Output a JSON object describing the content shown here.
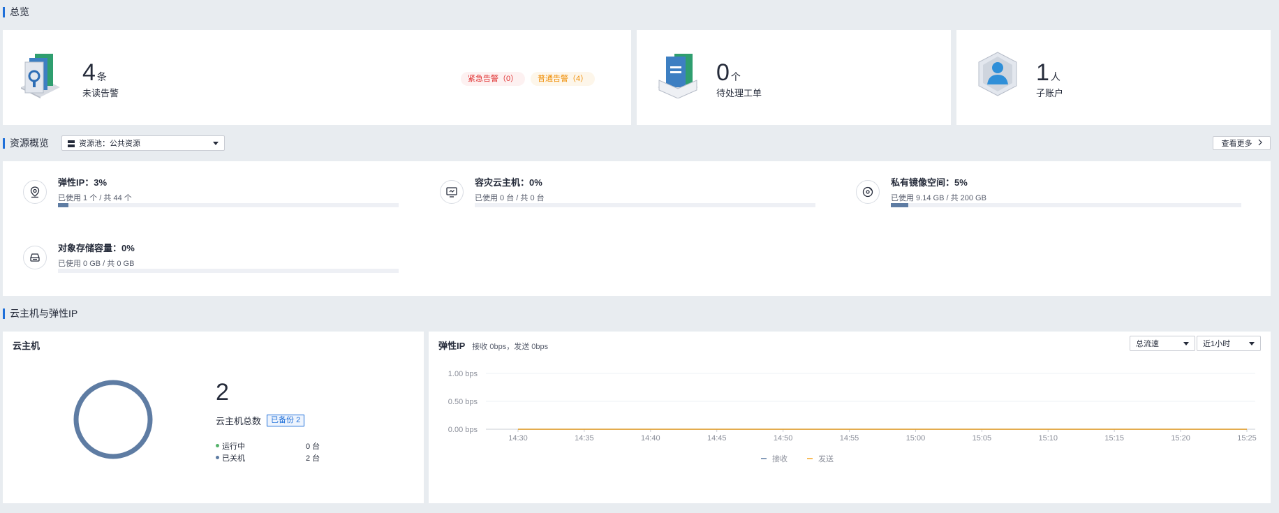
{
  "sections": {
    "overview": "总览",
    "resources": "资源概览",
    "vm_eip": "云主机与弹性IP"
  },
  "alerts": {
    "count": "4",
    "unit": "条",
    "label": "未读告警",
    "urgent": "紧急告警（0）",
    "normal": "普通告警（4）"
  },
  "tickets": {
    "count": "0",
    "unit": "个",
    "label": "待处理工单"
  },
  "subaccounts": {
    "count": "1",
    "unit": "人",
    "label": "子账户"
  },
  "pool": {
    "label": "资源池：公共资源"
  },
  "view_more": "查看更多",
  "resources": [
    {
      "name": "弹性IP：3%",
      "usage": "已使用 1 个 / 共 44 个",
      "percent": 3
    },
    {
      "name": "容灾云主机：0%",
      "usage": "已使用 0 台 / 共 0 台",
      "percent": 0
    },
    {
      "name": "私有镜像空间：5%",
      "usage": "已使用 9.14 GB / 共 200 GB",
      "percent": 5
    },
    {
      "name": "对象存储容量：0%",
      "usage": "已使用 0 GB / 共 0 GB",
      "percent": 0
    }
  ],
  "vm": {
    "title": "云主机",
    "total": "2",
    "total_label": "云主机总数",
    "backup_badge": "已备份 2",
    "status": [
      {
        "label": "运行中",
        "value": "0 台",
        "color": "#55b36b"
      },
      {
        "label": "已关机",
        "value": "2 台",
        "color": "#5e7ca3"
      }
    ],
    "ring_color": "#5e7ca3"
  },
  "eip": {
    "title": "弹性IP",
    "subtitle": "接收 0bps，发送 0bps",
    "select_metric": "总流速",
    "select_range": "近1小时"
  },
  "chart_data": {
    "type": "line",
    "x": [
      "14:30",
      "14:35",
      "14:40",
      "14:45",
      "14:50",
      "14:55",
      "15:00",
      "15:05",
      "15:10",
      "15:15",
      "15:20",
      "15:25"
    ],
    "y_ticks": [
      "1.00 bps",
      "0.50 bps",
      "0.00 bps"
    ],
    "ylim": [
      0,
      1
    ],
    "series": [
      {
        "name": "接收",
        "values": [
          0,
          0,
          0,
          0,
          0,
          0,
          0,
          0,
          0,
          0,
          0,
          0
        ],
        "color": "#5e7ca3"
      },
      {
        "name": "发送",
        "values": [
          0,
          0,
          0,
          0,
          0,
          0,
          0,
          0,
          0,
          0,
          0,
          0
        ],
        "color": "#f5a623"
      }
    ],
    "grid": true,
    "legend": "bottom-center"
  }
}
